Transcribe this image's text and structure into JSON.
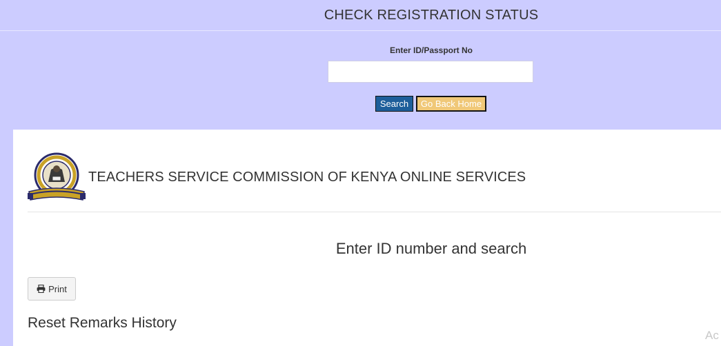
{
  "header": {
    "title": "CHECK REGISTRATION STATUS"
  },
  "search": {
    "label": "Enter ID/Passport No",
    "value": "",
    "placeholder": "",
    "search_button": "Search",
    "home_button": "Go Back Home"
  },
  "panel": {
    "org_name": "TEACHERS SERVICE COMMISSION OF KENYA ONLINE SERVICES",
    "logo_icon": "tsc-logo-icon",
    "enter_message": "Enter ID number and search",
    "print_button": "Print",
    "print_icon": "printer-icon",
    "reset_heading": "Reset Remarks History",
    "watermark": "Ac"
  },
  "colors": {
    "page_background": "#ccccff",
    "search_button": "#1d5e9a",
    "home_button": "#f0c878"
  }
}
